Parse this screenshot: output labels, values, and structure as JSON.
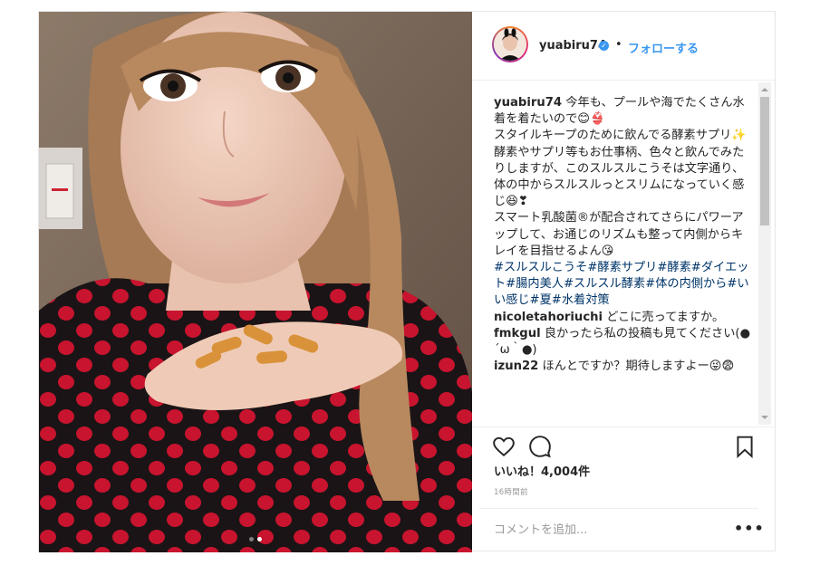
{
  "post": {
    "username": "yuabiru74",
    "verified_icon": "verified-badge-icon",
    "separator": "•",
    "follow_label": "フォローする"
  },
  "caption": {
    "username": "yuabiru74",
    "line1": "今年も、プールや海でたくさん水着を着たいので😊👙",
    "line2": "スタイルキープのために飲んでる酵素サプリ✨",
    "line3": "酵素やサプリ等もお仕事柄、色々と飲んでみたりしますが、このスルスルこうそは文字通り、体の中からスルスルっとスリムになっていく感じ😆❣",
    "line4": "スマート乳酸菌®が配合されてさらにパワーアップして、お通じのリズムも整って内側からキレイを目指せるよん😘",
    "hashtags": "#スルスルこうそ#酵素サプリ#酵素#ダイエット#腸内美人#スルスル酵素#体の内側から#いい感じ#夏#水着対策"
  },
  "comments": [
    {
      "user": "nicoletahoriuchi",
      "text": "どこに売ってますか。"
    },
    {
      "user": "fmkgul",
      "text": "良かったら私の投稿も見てください(●´ω｀●)"
    },
    {
      "user": "izun22",
      "text": "ほんとですか？期待しますよー😜😨"
    }
  ],
  "likes": "いいね！4,004件",
  "timestamp": "16時間前",
  "comment_placeholder": "コメントを追加...",
  "more_label": "•••",
  "icons": {
    "like": "heart-icon",
    "comment": "comment-bubble-icon",
    "save": "bookmark-icon"
  },
  "carousel": {
    "slides": 2,
    "active": 2
  },
  "colors": {
    "link": "#3897f0",
    "hashtag": "#003569",
    "border": "#efefef"
  }
}
